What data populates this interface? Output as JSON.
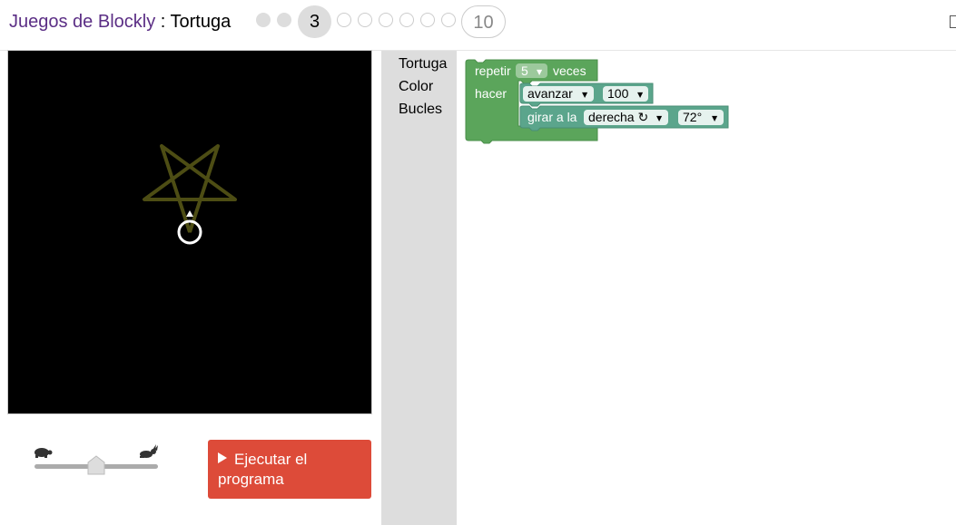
{
  "header": {
    "app_title": "Juegos de Blockly",
    "separator": " : ",
    "level_name": "Tortuga",
    "current_level": "3",
    "last_level": "10"
  },
  "toolbox": {
    "categories": [
      "Tortuga",
      "Color",
      "Bucles"
    ]
  },
  "blocks": {
    "repeat": {
      "label_prefix": "repetir",
      "times": "5",
      "label_suffix": "veces",
      "do_label": "hacer"
    },
    "move": {
      "action": "avanzar",
      "amount": "100"
    },
    "turn": {
      "label": "girar a la",
      "direction": "derecha ↻",
      "angle": "72°"
    }
  },
  "run_button": {
    "label": "Ejecutar el programa"
  },
  "colors": {
    "title_link": "#5b2e85",
    "loop_block": "#5ba55b",
    "turtle_block": "#5ba58c",
    "run_button": "#dd4b39",
    "canvas": "#000000",
    "star_stroke": "#4d4d14"
  },
  "icons": [
    "turtle-icon",
    "rabbit-icon",
    "play-icon"
  ]
}
